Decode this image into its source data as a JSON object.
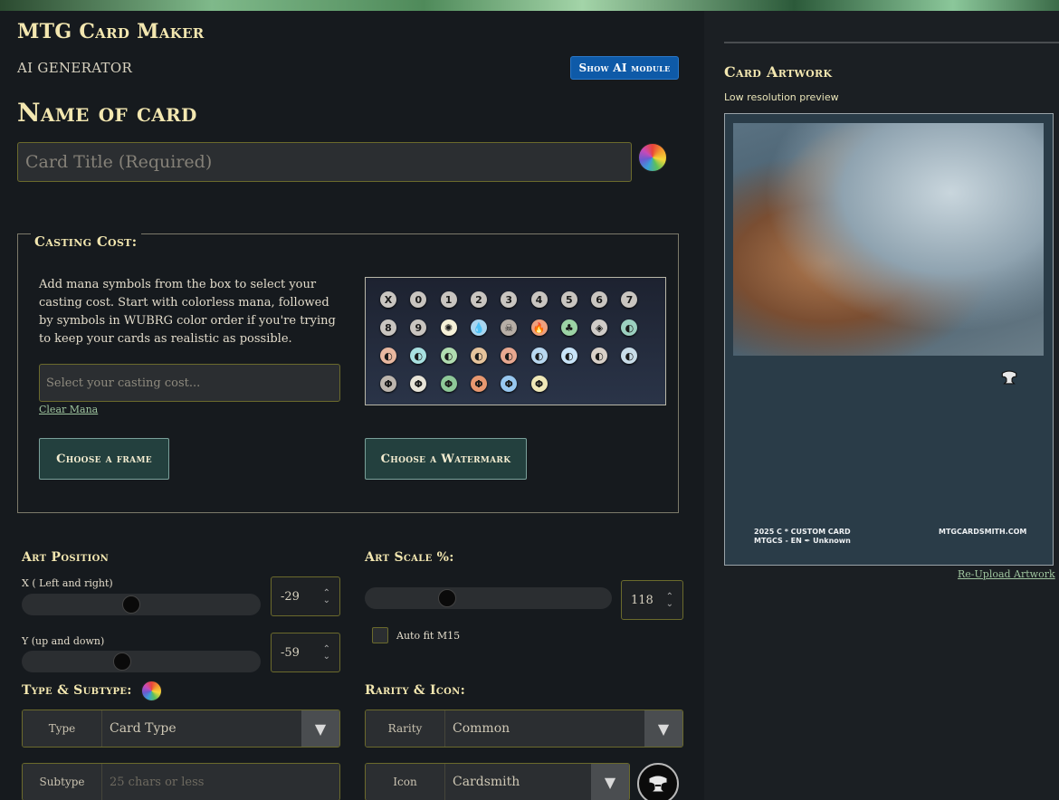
{
  "header": {
    "app_title": "MTG Card Maker",
    "ai_generator": "AI GENERATOR",
    "show_ai_button": "Show AI module"
  },
  "name_section": {
    "heading": "Name of card",
    "title_placeholder": "Card Title (Required)"
  },
  "casting_cost": {
    "legend": "Casting Cost:",
    "description": "Add mana symbols from the box to select your casting cost. Start with colorless mana, followed by symbols in WUBRG color order if you're trying to keep your cards as realistic as possible.",
    "input_placeholder": "Select your casting cost...",
    "clear_link": "Clear Mana",
    "mana_symbols": [
      {
        "glyph": "X",
        "color": "#c9c5c0"
      },
      {
        "glyph": "0",
        "color": "#c9c5c0"
      },
      {
        "glyph": "1",
        "color": "#c9c5c0"
      },
      {
        "glyph": "2",
        "color": "#c9c5c0"
      },
      {
        "glyph": "3",
        "color": "#c9c5c0"
      },
      {
        "glyph": "4",
        "color": "#c9c5c0"
      },
      {
        "glyph": "5",
        "color": "#c9c5c0"
      },
      {
        "glyph": "6",
        "color": "#c9c5c0"
      },
      {
        "glyph": "7",
        "color": "#c9c5c0"
      },
      {
        "glyph": "8",
        "color": "#c9c5c0"
      },
      {
        "glyph": "9",
        "color": "#c9c5c0"
      },
      {
        "glyph": "✺",
        "color": "#f6f1d8"
      },
      {
        "glyph": "💧",
        "color": "#a8d6f0"
      },
      {
        "glyph": "☠",
        "color": "#b7aea6"
      },
      {
        "glyph": "🔥",
        "color": "#eea07e"
      },
      {
        "glyph": "♣",
        "color": "#9cd3a5"
      },
      {
        "glyph": "◈",
        "color": "#d0ccc8"
      },
      {
        "glyph": "◐",
        "color": "#9cd0c0"
      },
      {
        "glyph": "◐",
        "color": "#e8b8a0"
      },
      {
        "glyph": "◐",
        "color": "#a8e0e0"
      },
      {
        "glyph": "◐",
        "color": "#b0dcb0"
      },
      {
        "glyph": "◐",
        "color": "#e6c49c"
      },
      {
        "glyph": "◐",
        "color": "#e8a890"
      },
      {
        "glyph": "◐",
        "color": "#b8d8f0"
      },
      {
        "glyph": "◐",
        "color": "#c8e4f8"
      },
      {
        "glyph": "◐",
        "color": "#d8d0c8"
      },
      {
        "glyph": "◐",
        "color": "#c8dce8"
      },
      {
        "glyph": "Φ",
        "color": "#bdb6ae"
      },
      {
        "glyph": "Φ",
        "color": "#e8e4d8"
      },
      {
        "glyph": "Φ",
        "color": "#8ec898"
      },
      {
        "glyph": "Φ",
        "color": "#e89870"
      },
      {
        "glyph": "Φ",
        "color": "#98c8f0"
      },
      {
        "glyph": "Φ",
        "color": "#f0e8b8"
      }
    ]
  },
  "buttons": {
    "choose_frame": "Choose a frame",
    "choose_watermark": "Choose a Watermark"
  },
  "art_position": {
    "heading": "Art Position",
    "x_label": "X ( Left and right)",
    "x_value": "-29",
    "y_label": "Y (up and down)",
    "y_value": "-59"
  },
  "art_scale": {
    "heading": "Art Scale %:",
    "value": "118",
    "auto_fit_label": "Auto fit M15"
  },
  "type_subtype": {
    "heading": "Type & Subtype:",
    "type_label": "Type",
    "type_value": "Card Type",
    "subtype_label": "Subtype",
    "subtype_placeholder": "25 chars or less"
  },
  "rarity_icon": {
    "heading": "Rarity & Icon:",
    "rarity_label": "Rarity",
    "rarity_value": "Common",
    "icon_label": "Icon",
    "icon_value": "Cardsmith"
  },
  "artwork_panel": {
    "heading": "Card Artwork",
    "subtitle": "Low resolution preview",
    "footer_left_line1": "2025 C * CUSTOM CARD",
    "footer_left_line2": "MTGCS - EN ✒ Unknown",
    "footer_right": "MTGCARDSMITH.COM",
    "reupload": "Re-Upload Artwork"
  },
  "colors": {
    "gold_text": "#f3e7b0",
    "accent_blue": "#0e5aa8",
    "teal_button": "#23403e",
    "input_border": "#6b6a2c"
  }
}
